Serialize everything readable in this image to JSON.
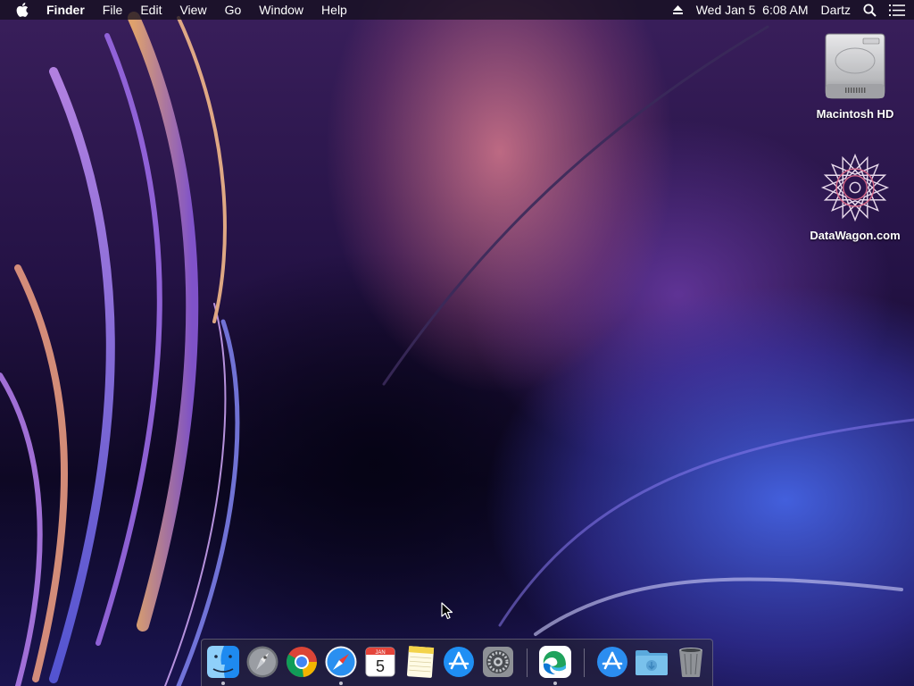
{
  "menubar": {
    "app_name": "Finder",
    "menus": [
      "File",
      "Edit",
      "View",
      "Go",
      "Window",
      "Help"
    ],
    "datetime": "Wed Jan 5  6:08 AM",
    "user": "Dartz",
    "icons": [
      "apple-icon",
      "eject-icon",
      "spotlight-search-icon",
      "control-center-icon"
    ]
  },
  "desktop": {
    "icons": [
      {
        "label": "Macintosh HD",
        "icon": "hard-drive-icon"
      },
      {
        "label": "DataWagon.com",
        "icon": "datawagon-logo-icon"
      }
    ]
  },
  "dock": {
    "items": [
      {
        "name": "Finder",
        "icon": "finder-icon",
        "running": true
      },
      {
        "name": "Launchpad",
        "icon": "launchpad-icon",
        "running": false
      },
      {
        "name": "Google Chrome",
        "icon": "chrome-icon",
        "running": false
      },
      {
        "name": "Safari",
        "icon": "safari-icon",
        "running": true
      },
      {
        "name": "Calendar",
        "icon": "calendar-icon",
        "running": false,
        "month": "JAN",
        "day": "5"
      },
      {
        "name": "Notes",
        "icon": "notes-icon",
        "running": false
      },
      {
        "name": "App Store",
        "icon": "app-store-icon",
        "running": false
      },
      {
        "name": "System Preferences",
        "icon": "system-preferences-icon",
        "running": false
      },
      {
        "name": "Microsoft Edge",
        "icon": "edge-icon",
        "running": true
      },
      {
        "name": "Applications",
        "icon": "applications-folder-icon",
        "running": false
      },
      {
        "name": "Downloads",
        "icon": "downloads-folder-icon",
        "running": false
      },
      {
        "name": "Trash",
        "icon": "trash-icon",
        "running": false
      }
    ]
  }
}
